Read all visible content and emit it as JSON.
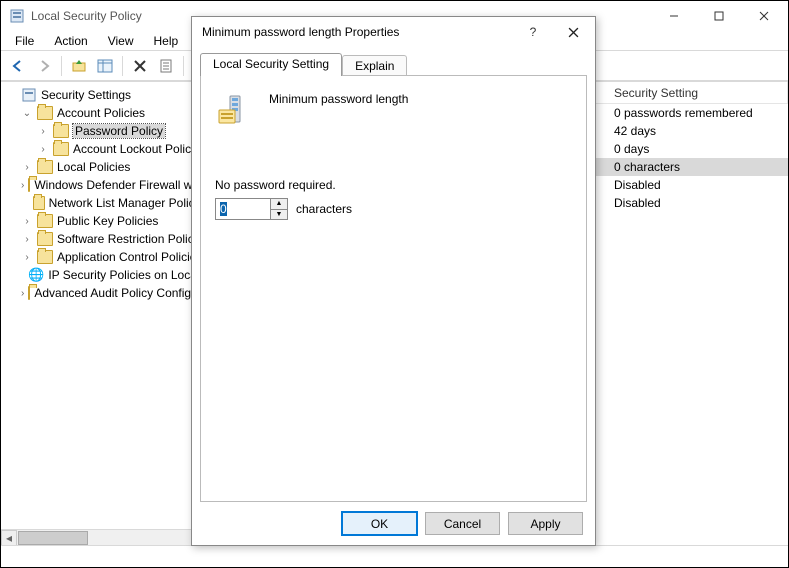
{
  "window": {
    "title": "Local Security Policy"
  },
  "menubar": [
    "File",
    "Action",
    "View",
    "Help"
  ],
  "tree": {
    "root": "Security Settings",
    "account_policies": "Account Policies",
    "password_policy": "Password Policy",
    "account_lockout_policy": "Account Lockout Policy",
    "local_policies": "Local Policies",
    "defender_firewall": "Windows Defender Firewall with Advanced Security",
    "network_list_mgr": "Network List Manager Policies",
    "public_key": "Public Key Policies",
    "software_restriction": "Software Restriction Policies",
    "app_control": "Application Control Policies",
    "ip_security": "IP Security Policies on Local Computer",
    "advanced_audit": "Advanced Audit Policy Configuration"
  },
  "list": {
    "header_security_setting": "Security Setting",
    "rows": {
      "r0": "0 passwords remembered",
      "r1": "42 days",
      "r2": "0 days",
      "r3": "0 characters",
      "r4": "Disabled",
      "r5": "Disabled"
    },
    "selected_index": 3
  },
  "dialog": {
    "title": "Minimum password length Properties",
    "tabs": {
      "local": "Local Security Setting",
      "explain": "Explain"
    },
    "policy_name": "Minimum password length",
    "setting_text": "No password required.",
    "spinner_value": "0",
    "unit_label": "characters",
    "buttons": {
      "ok": "OK",
      "cancel": "Cancel",
      "apply": "Apply"
    }
  }
}
